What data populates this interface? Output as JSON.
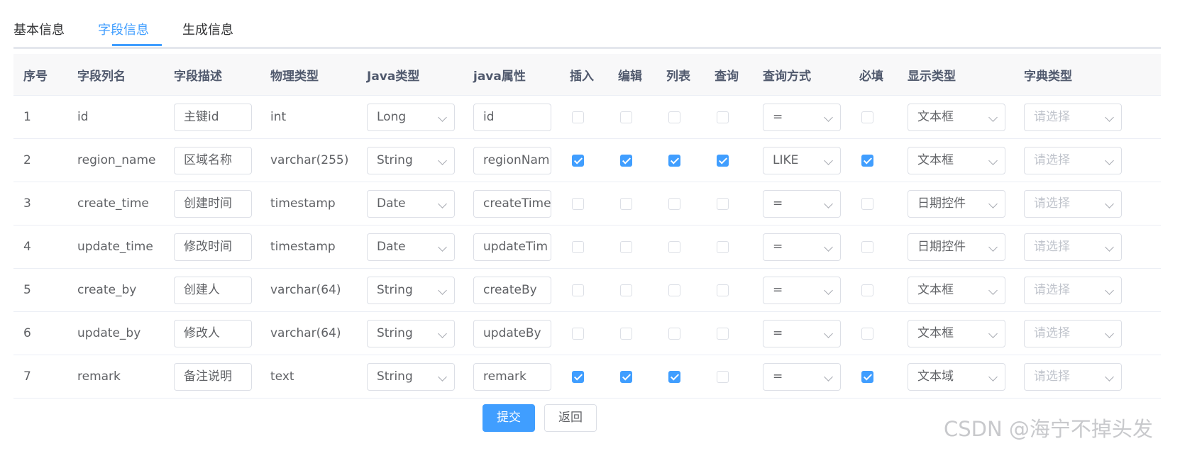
{
  "tabs": [
    "基本信息",
    "字段信息",
    "生成信息"
  ],
  "active_tab": "字段信息",
  "columns": [
    "序号",
    "字段列名",
    "字段描述",
    "物理类型",
    "Java类型",
    "java属性",
    "插入",
    "编辑",
    "列表",
    "查询",
    "查询方式",
    "必填",
    "显示类型",
    "字典类型"
  ],
  "rows": [
    {
      "no": "1",
      "column_name": "id",
      "description": "主键id",
      "physical_type": "int",
      "java_type": "Long",
      "java_attr": "id",
      "insert": false,
      "edit": false,
      "list": false,
      "query": false,
      "query_type": "=",
      "required": false,
      "display_type": "文本框",
      "dict_type": "请选择"
    },
    {
      "no": "2",
      "column_name": "region_name",
      "description": "区域名称",
      "physical_type": "varchar(255)",
      "java_type": "String",
      "java_attr": "regionNam",
      "insert": true,
      "edit": true,
      "list": true,
      "query": true,
      "query_type": "LIKE",
      "required": true,
      "display_type": "文本框",
      "dict_type": "请选择"
    },
    {
      "no": "3",
      "column_name": "create_time",
      "description": "创建时间",
      "physical_type": "timestamp",
      "java_type": "Date",
      "java_attr": "createTime",
      "insert": false,
      "edit": false,
      "list": false,
      "query": false,
      "query_type": "=",
      "required": false,
      "display_type": "日期控件",
      "dict_type": "请选择"
    },
    {
      "no": "4",
      "column_name": "update_time",
      "description": "修改时间",
      "physical_type": "timestamp",
      "java_type": "Date",
      "java_attr": "updateTim",
      "insert": false,
      "edit": false,
      "list": false,
      "query": false,
      "query_type": "=",
      "required": false,
      "display_type": "日期控件",
      "dict_type": "请选择"
    },
    {
      "no": "5",
      "column_name": "create_by",
      "description": "创建人",
      "physical_type": "varchar(64)",
      "java_type": "String",
      "java_attr": "createBy",
      "insert": false,
      "edit": false,
      "list": false,
      "query": false,
      "query_type": "=",
      "required": false,
      "display_type": "文本框",
      "dict_type": "请选择"
    },
    {
      "no": "6",
      "column_name": "update_by",
      "description": "修改人",
      "physical_type": "varchar(64)",
      "java_type": "String",
      "java_attr": "updateBy",
      "insert": false,
      "edit": false,
      "list": false,
      "query": false,
      "query_type": "=",
      "required": false,
      "display_type": "文本框",
      "dict_type": "请选择"
    },
    {
      "no": "7",
      "column_name": "remark",
      "description": "备注说明",
      "physical_type": "text",
      "java_type": "String",
      "java_attr": "remark",
      "insert": true,
      "edit": true,
      "list": true,
      "query": false,
      "query_type": "=",
      "required": true,
      "display_type": "文本域",
      "dict_type": "请选择"
    }
  ],
  "buttons": {
    "submit": "提交",
    "back": "返回"
  },
  "watermark": "CSDN @海宁不掉头发",
  "colors": {
    "accent": "#409eff",
    "header_bg": "#f8f8f9",
    "border": "#dcdfe6",
    "placeholder": "#c0c4cc"
  }
}
